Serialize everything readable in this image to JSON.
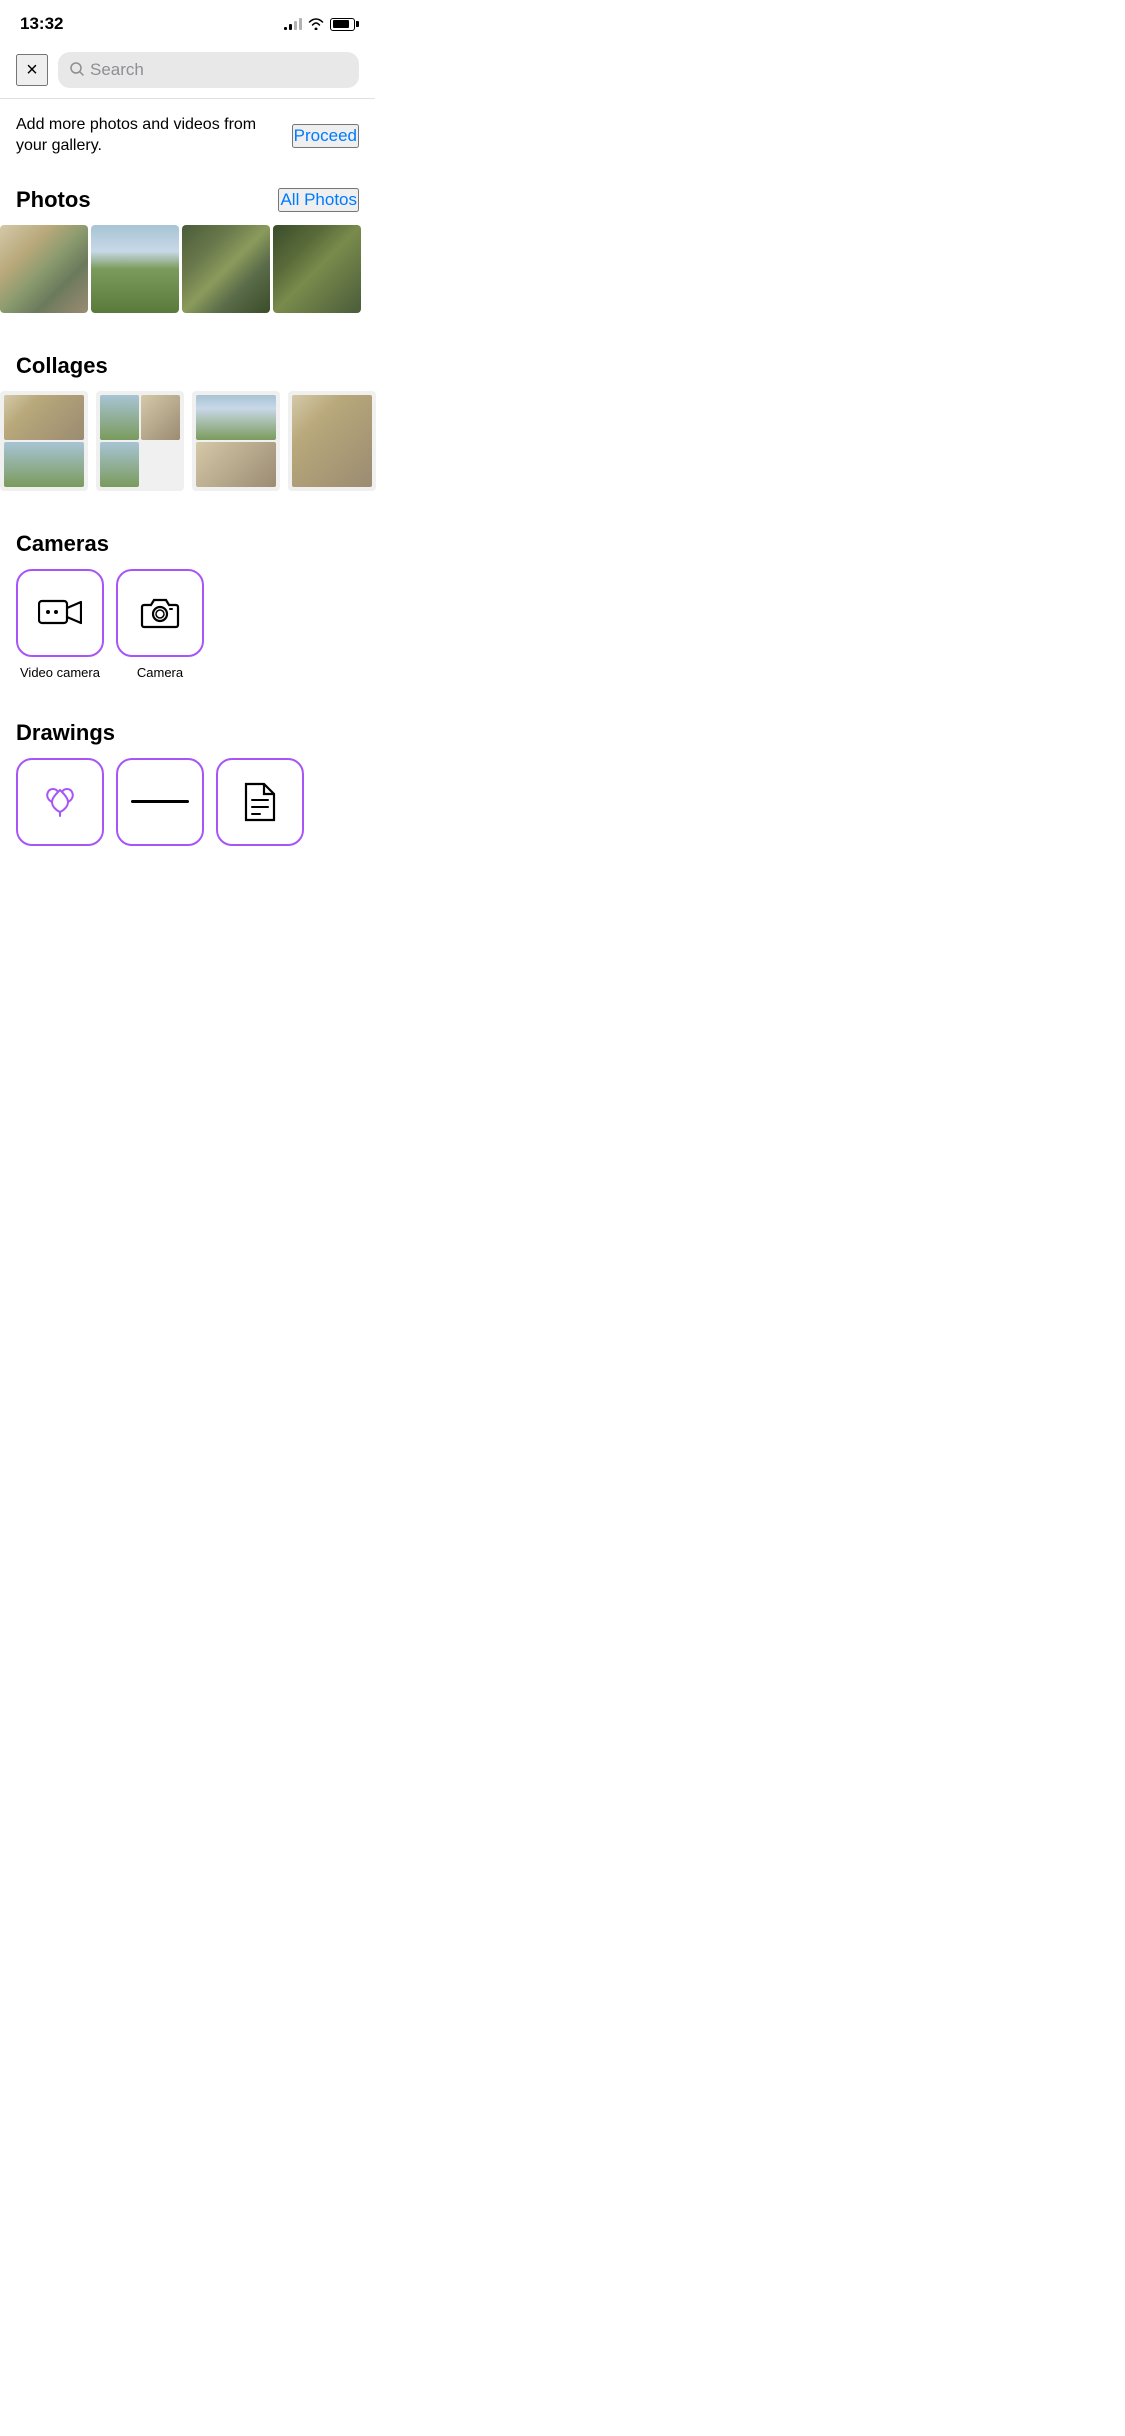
{
  "statusBar": {
    "time": "13:32",
    "signal": "2 bars",
    "wifi": true,
    "battery": 80
  },
  "topNav": {
    "closeLabel": "×",
    "searchPlaceholder": "Search"
  },
  "addPhotos": {
    "text": "Add more photos and videos from your gallery.",
    "proceedLabel": "Proceed"
  },
  "photosSection": {
    "title": "Photos",
    "allPhotosLabel": "All Photos",
    "photos": [
      {
        "id": "desk",
        "alt": "Desk with chair"
      },
      {
        "id": "field",
        "alt": "Green field with clouds"
      },
      {
        "id": "bush",
        "alt": "Bush/tree close-up"
      },
      {
        "id": "bush2",
        "alt": "Bush/tree close-up 2"
      }
    ]
  },
  "collagesSection": {
    "title": "Collages",
    "collages": [
      {
        "id": "collage-1",
        "alt": "Collage 1: desk and field"
      },
      {
        "id": "collage-2",
        "alt": "Collage 2: field and desk"
      },
      {
        "id": "collage-3",
        "alt": "Collage 3: field and desk"
      },
      {
        "id": "collage-4",
        "alt": "Collage 4: desk"
      }
    ]
  },
  "camerasSection": {
    "title": "Cameras",
    "cameras": [
      {
        "id": "video-camera",
        "label": "Video camera",
        "icon": "video"
      },
      {
        "id": "camera",
        "label": "Camera",
        "icon": "camera"
      }
    ]
  },
  "drawingsSection": {
    "title": "Drawings",
    "items": [
      {
        "id": "drawing-crown",
        "icon": "crown"
      },
      {
        "id": "drawing-line",
        "icon": "line"
      },
      {
        "id": "drawing-file",
        "icon": "file"
      }
    ]
  },
  "colors": {
    "accent": "#007aff",
    "purple": "#a855f7",
    "border": "#e0e0e0"
  }
}
